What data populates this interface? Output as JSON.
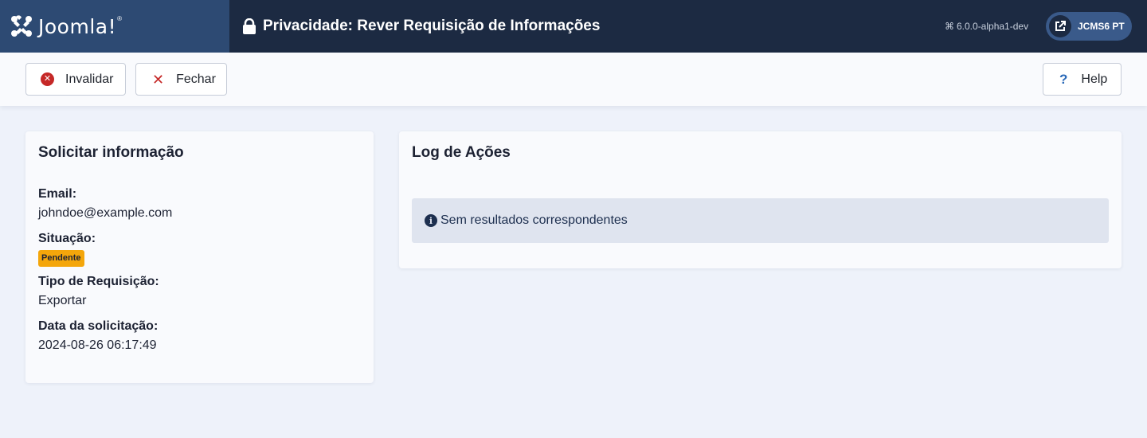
{
  "header": {
    "logo_text": "Joomla!",
    "logo_reg": "®",
    "title": "Privacidade: Rever Requisição de Informações",
    "version_icon": "joomla-icon",
    "version": "6.0.0-alpha1-dev",
    "site_button_label": "JCMS6 PT"
  },
  "toolbar": {
    "invalidate_label": "Invalidar",
    "close_label": "Fechar",
    "help_label": "Help"
  },
  "request_info": {
    "title": "Solicitar informação",
    "email_label": "Email:",
    "email_value": "johndoe@example.com",
    "status_label": "Situação:",
    "status_value": "Pendente",
    "type_label": "Tipo de Requisição:",
    "type_value": "Exportar",
    "date_label": "Data da solicitação:",
    "date_value": "2024-08-26 06:17:49"
  },
  "action_log": {
    "title": "Log de Ações",
    "empty_message": "Sem resultados correspondentes"
  },
  "colors": {
    "header_bg": "#1c2a42",
    "logo_bg": "#2d4a73",
    "danger": "#c52827",
    "warning_badge": "#f4a60b",
    "info_alert_bg": "#dfe4ef"
  }
}
